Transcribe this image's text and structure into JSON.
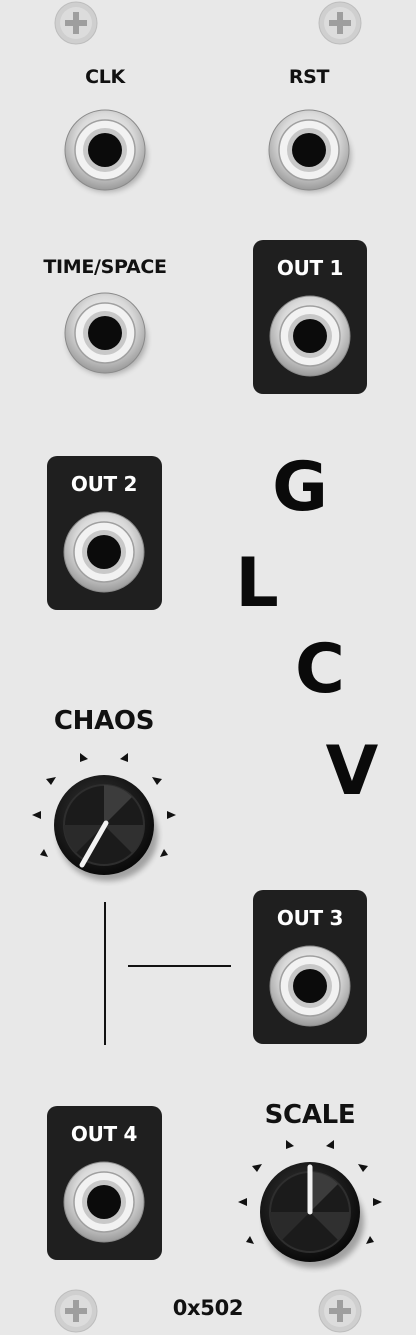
{
  "module": {
    "brand": "0x502",
    "logo_letters": [
      "G",
      "L",
      "C",
      "V"
    ],
    "inputs": {
      "clk_label": "CLK",
      "rst_label": "RST",
      "timespace_label": "TIME/SPACE"
    },
    "outputs": {
      "out1_label": "OUT 1",
      "out2_label": "OUT 2",
      "out3_label": "OUT 3",
      "out4_label": "OUT 4"
    },
    "knobs": {
      "chaos_label": "CHAOS",
      "scale_label": "SCALE"
    }
  },
  "colors": {
    "panel": "#e8e8e8",
    "output_box": "#1f1f1f",
    "text": "#111111",
    "indicator": "#ffffff"
  },
  "icons": [
    "screw-icon",
    "jack-icon",
    "knob-icon",
    "tick-mark-icon"
  ]
}
